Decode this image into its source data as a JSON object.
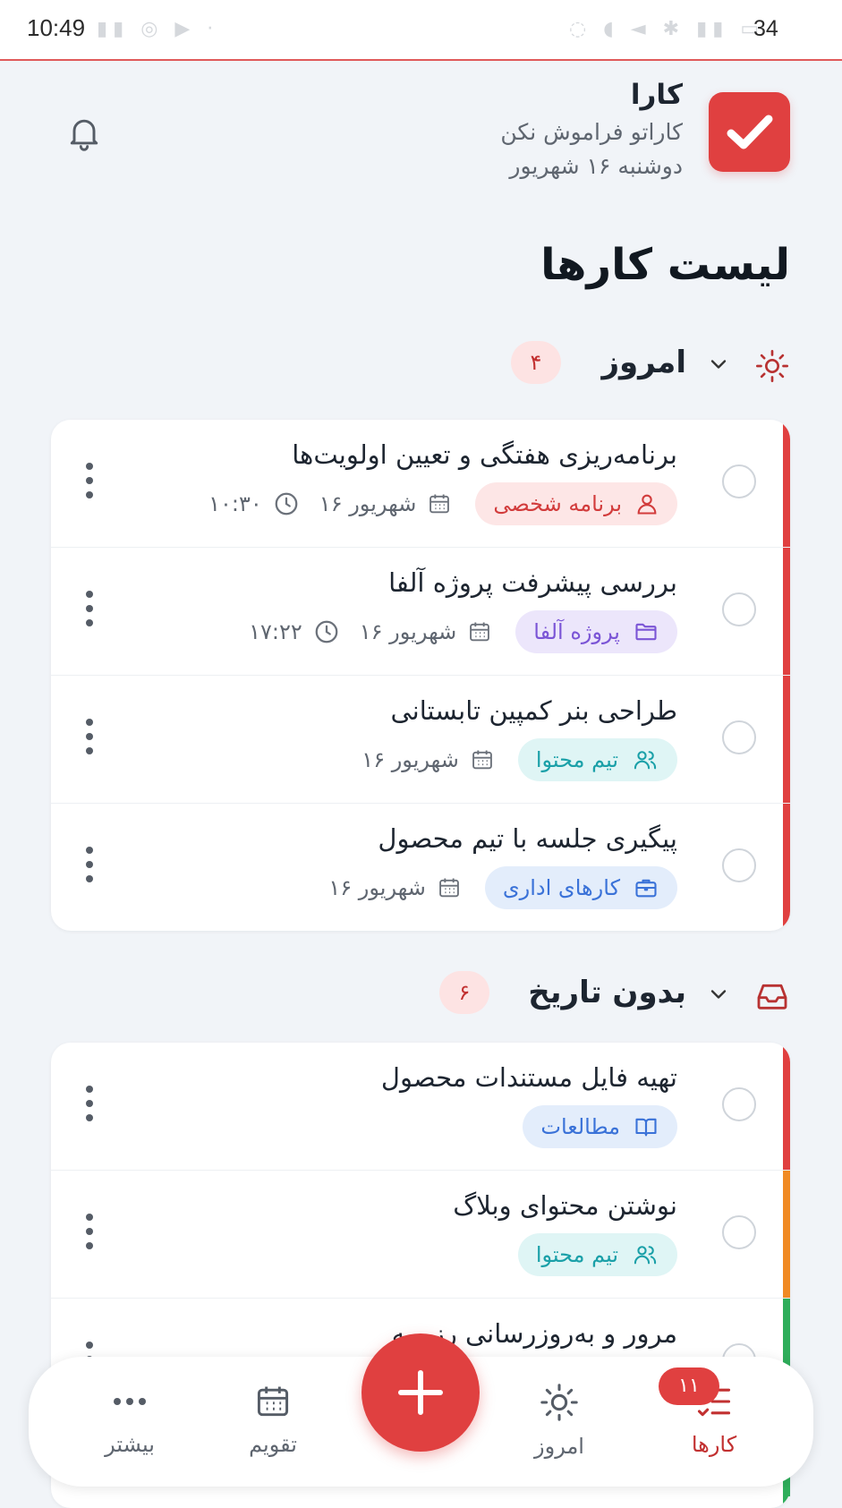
{
  "status_bar": {
    "time": "10:49",
    "battery": "34"
  },
  "header": {
    "app_name": "کارا",
    "tagline": "کاراتو فراموش نکن",
    "date": "دوشنبه ۱۶ شهریور",
    "notification_icon": "bell-icon",
    "logo_icon": "checkmark-icon",
    "accent_color": "#e04040"
  },
  "page_title": "لیست کارها",
  "sections": [
    {
      "title": "امروز",
      "count": "۴",
      "icon": "sun-icon",
      "tasks": [
        {
          "title": "برنامه‌ریزی هفتگی و تعیین اولویت‌ها",
          "tag": "برنامه شخصی",
          "tag_icon": "user-icon",
          "date": "۱۶ شهریور",
          "time": "۱۰:۳۰",
          "stripe_color": "#e04040"
        },
        {
          "title": "بررسی پیشرفت پروژه آلفا",
          "tag": "پروژه آلفا",
          "tag_icon": "folder-icon",
          "date": "۱۶ شهریور",
          "time": "۱۷:۲۲",
          "stripe_color": "#e04040"
        },
        {
          "title": "طراحی بنر کمپین تابستانی",
          "tag": "تیم محتوا",
          "tag_icon": "users-icon",
          "date": "۱۶ شهریور",
          "stripe_color": "#e04040"
        },
        {
          "title": "پیگیری جلسه با تیم محصول",
          "tag": "کارهای اداری",
          "tag_icon": "briefcase-icon",
          "date": "۱۶ شهریور",
          "stripe_color": "#e04040"
        }
      ]
    },
    {
      "title": "بدون تاریخ",
      "count": "۶",
      "icon": "inbox-icon",
      "tasks": [
        {
          "title": "تهیه فایل مستندات محصول",
          "tag": "مطالعات",
          "tag_icon": "book-icon",
          "stripe_color": "#e04040"
        },
        {
          "title": "نوشتن محتوای وبلاگ",
          "tag": "تیم محتوا",
          "tag_icon": "users-icon",
          "stripe_color": "#f08a24"
        },
        {
          "title": "مرور و به‌روزرسانی رزومه",
          "stripe_color": "#2fae5b"
        }
      ]
    }
  ],
  "bottom_nav": {
    "tasks_label": "کارها",
    "tasks_badge": "۱۱",
    "today_label": "امروز",
    "calendar_label": "تقویم",
    "more_label": "بیشتر",
    "add_icon": "plus-icon"
  }
}
